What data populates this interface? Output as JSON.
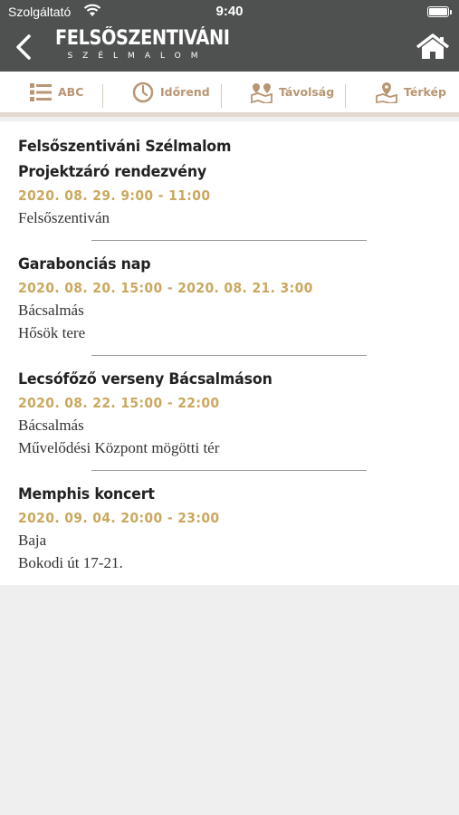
{
  "status_bar": {
    "carrier": "Szolgáltató",
    "time": "9:40"
  },
  "header": {
    "brand_title": "FELSŐSZENTIVÁNI",
    "brand_subtitle": "SZÉLMALOM"
  },
  "toolbar": [
    {
      "label": "ABC",
      "icon": "abc-list-icon"
    },
    {
      "label": "Időrend",
      "icon": "clock-icon"
    },
    {
      "label": "Távolság",
      "icon": "map-pin-distance-icon"
    },
    {
      "label": "Térkép",
      "icon": "map-icon"
    }
  ],
  "events": [
    {
      "title_lines": [
        "Felsőszentiváni Szélmalom",
        "Projektzáró rendezvény"
      ],
      "date": "2020. 08. 29. 9:00 - 11:00",
      "location_lines": [
        "Felsőszentiván"
      ]
    },
    {
      "title_lines": [
        "Garabonciás nap"
      ],
      "date": "2020. 08. 20. 15:00 - 2020. 08. 21. 3:00",
      "location_lines": [
        "Bácsalmás",
        "Hősök tere"
      ]
    },
    {
      "title_lines": [
        "Lecsófőző verseny Bácsalmáson"
      ],
      "date": "2020. 08. 22. 15:00 - 22:00",
      "location_lines": [
        "Bácsalmás",
        "Művelődési Központ mögötti tér"
      ]
    },
    {
      "title_lines": [
        "Memphis koncert"
      ],
      "date": "2020. 09. 04. 20:00 - 23:00",
      "location_lines": [
        "Baja",
        "Bokodi út 17-21."
      ]
    }
  ],
  "colors": {
    "header_bg": "#4f5150",
    "accent_gold": "#caa85f",
    "toolbar_brown": "#b89674"
  }
}
